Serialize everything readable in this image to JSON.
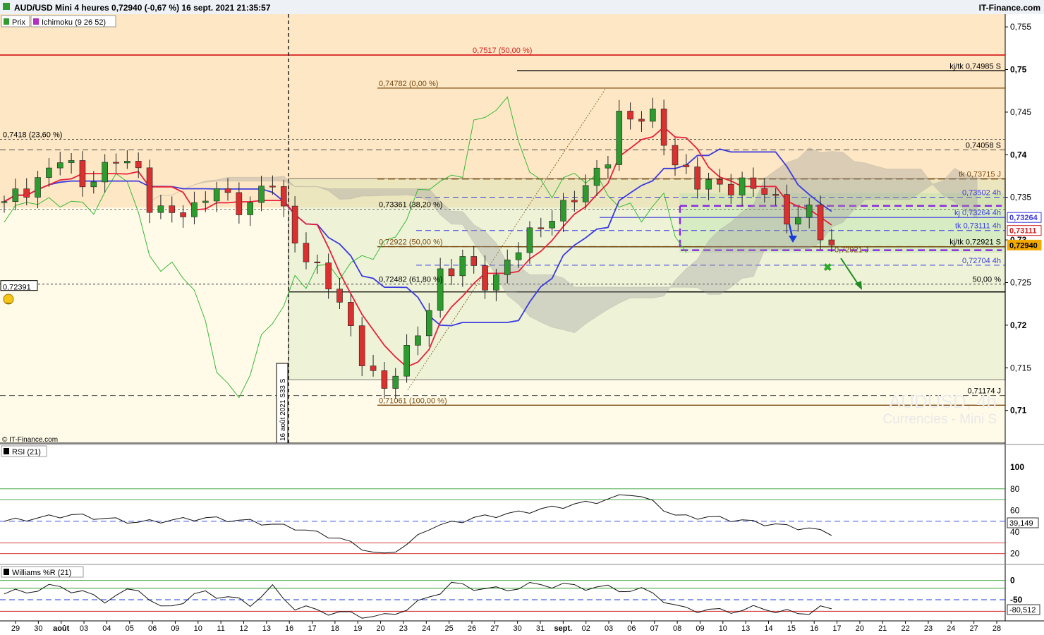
{
  "header": {
    "title": "AUD/USD Mini 4 heures 0,72940 (-0,67 %) 16 sept. 2021 21:35:57",
    "source": "IT-Finance.com"
  },
  "legend": {
    "price_label": "Prix",
    "ichimoku_label": "Ichimoku (9 26 52)"
  },
  "watermark": {
    "line1": "AUDUSD, 4h",
    "line2": "Currencies - Mini S"
  },
  "copyright": "© IT-Finance.com",
  "vertical_marker": "16 août 2021 S33 S",
  "colors": {
    "candle_up": "#2e9b2e",
    "candle_down": "#d93030",
    "tenkan": "#e8203a",
    "kijun": "#3a3ae0",
    "chikou": "#39b939",
    "fib": "#7a4a10",
    "resistance": "#d42020",
    "background": "#fde7c4"
  },
  "chart_data": [
    {
      "type": "candlestick",
      "title": "AUD/USD Mini 4 heures",
      "ylim": [
        0.7055,
        0.7565
      ],
      "y_ticks": [
        "0,755",
        "0,75",
        "0,745",
        "0,74",
        "0,735",
        "0,73",
        "0,725",
        "0,72",
        "0,715",
        "0,71"
      ],
      "x_ticks": [
        "29",
        "30",
        "août",
        "03",
        "04",
        "05",
        "06",
        "09",
        "10",
        "11",
        "12",
        "13",
        "16",
        "17",
        "18",
        "19",
        "20",
        "23",
        "24",
        "25",
        "26",
        "27",
        "30",
        "31",
        "sept.",
        "02",
        "03",
        "06",
        "07",
        "08",
        "09",
        "10",
        "13",
        "14",
        "15",
        "16",
        "17",
        "20",
        "21",
        "22",
        "23",
        "24",
        "27",
        "28"
      ],
      "close_waypoints": [
        {
          "x": 0,
          "y": 0.734
        },
        {
          "x": 5,
          "y": 0.7395
        },
        {
          "x": 7,
          "y": 0.7365
        },
        {
          "x": 10,
          "y": 0.7398
        },
        {
          "x": 12,
          "y": 0.7375
        },
        {
          "x": 13,
          "y": 0.7342
        },
        {
          "x": 15,
          "y": 0.7335
        },
        {
          "x": 17,
          "y": 0.733
        },
        {
          "x": 19,
          "y": 0.7365
        },
        {
          "x": 21,
          "y": 0.734
        },
        {
          "x": 22,
          "y": 0.7338
        },
        {
          "x": 24,
          "y": 0.737
        },
        {
          "x": 26,
          "y": 0.7302
        },
        {
          "x": 28,
          "y": 0.726
        },
        {
          "x": 30,
          "y": 0.7228
        },
        {
          "x": 32,
          "y": 0.7165
        },
        {
          "x": 34,
          "y": 0.7118
        },
        {
          "x": 35,
          "y": 0.7145
        },
        {
          "x": 37,
          "y": 0.7195
        },
        {
          "x": 39,
          "y": 0.7255
        },
        {
          "x": 40,
          "y": 0.726
        },
        {
          "x": 41,
          "y": 0.7278
        },
        {
          "x": 43,
          "y": 0.7255
        },
        {
          "x": 44,
          "y": 0.7255
        },
        {
          "x": 46,
          "y": 0.7288
        },
        {
          "x": 48,
          "y": 0.7322
        },
        {
          "x": 50,
          "y": 0.7338
        },
        {
          "x": 52,
          "y": 0.7358
        },
        {
          "x": 54,
          "y": 0.7402
        },
        {
          "x": 55,
          "y": 0.7448
        },
        {
          "x": 56,
          "y": 0.744
        },
        {
          "x": 58,
          "y": 0.7442
        },
        {
          "x": 60,
          "y": 0.7395
        },
        {
          "x": 62,
          "y": 0.7365
        },
        {
          "x": 64,
          "y": 0.736
        },
        {
          "x": 66,
          "y": 0.737
        },
        {
          "x": 68,
          "y": 0.7355
        },
        {
          "x": 70,
          "y": 0.7325
        },
        {
          "x": 72,
          "y": 0.7338
        },
        {
          "x": 73,
          "y": 0.7308
        },
        {
          "x": 74,
          "y": 0.7294
        }
      ],
      "levels": [
        {
          "label": "0,7517 (50,00 %)",
          "value": 0.7517,
          "kind": "resistance"
        },
        {
          "label": "kj/tk 0,74985 S",
          "value": 0.74985,
          "kind": "black"
        },
        {
          "label": "0,74782 (0,00 %)",
          "value": 0.74782,
          "kind": "fib"
        },
        {
          "label": "0,7418 (23,60 %)",
          "value": 0.7418,
          "kind": "dotted"
        },
        {
          "label": "0,74058 S",
          "value": 0.74058,
          "kind": "dashed"
        },
        {
          "label": "tk 0,73715 J",
          "value": 0.73715,
          "kind": "fib_dashed"
        },
        {
          "label": "0,73502 4h",
          "value": 0.73502,
          "kind": "blue_dashed"
        },
        {
          "label": "kj 0,73264 4h",
          "value": 0.73264,
          "kind": "blue"
        },
        {
          "label": "0,73361 (38,20 %)",
          "value": 0.73361,
          "kind": "dotted"
        },
        {
          "label": "tk 0,73111 4h",
          "value": 0.73111,
          "kind": "blue_dashed"
        },
        {
          "label": "0,72922 (50,00 %)",
          "value": 0.72922,
          "kind": "fib_dashed"
        },
        {
          "label": "kj/tk 0,72921 S",
          "value": 0.72921,
          "kind": "black"
        },
        {
          "label": "0,72921 J",
          "value": 0.72921,
          "kind": "fib"
        },
        {
          "label": "0,72704 4h",
          "value": 0.72704,
          "kind": "blue_dashed"
        },
        {
          "label": "0,72482 (61,80 %)",
          "value": 0.72482,
          "kind": "dotted"
        },
        {
          "label": "50,00 %",
          "value": 0.72482,
          "kind": "dotted"
        },
        {
          "label": "0,72391",
          "value": 0.72391,
          "kind": "black"
        },
        {
          "label": "0,71174 J",
          "value": 0.71174,
          "kind": "dashed"
        },
        {
          "label": "0,71061 (100,00 %)",
          "value": 0.71061,
          "kind": "fib"
        }
      ],
      "price_badges": [
        {
          "text": "0,73264",
          "value": 0.73264,
          "color": "#3a3ae0"
        },
        {
          "text": "0,73111",
          "value": 0.73111,
          "color": "#d42020"
        },
        {
          "text": "0,72940",
          "value": 0.7294,
          "color": "#f2a900"
        }
      ]
    },
    {
      "type": "line",
      "title": "RSI (21)",
      "ylim": [
        10,
        108
      ],
      "y_ticks": [
        "100",
        "80",
        "60",
        "40",
        "20"
      ],
      "ref_lines": [
        80,
        70,
        50,
        30,
        20
      ],
      "last_value": "39,149",
      "waypoints": [
        {
          "x": 0,
          "y": 50
        },
        {
          "x": 6,
          "y": 56
        },
        {
          "x": 12,
          "y": 49
        },
        {
          "x": 18,
          "y": 53
        },
        {
          "x": 22,
          "y": 50
        },
        {
          "x": 26,
          "y": 44
        },
        {
          "x": 30,
          "y": 34
        },
        {
          "x": 33,
          "y": 21
        },
        {
          "x": 34,
          "y": 19
        },
        {
          "x": 36,
          "y": 28
        },
        {
          "x": 38,
          "y": 44
        },
        {
          "x": 42,
          "y": 53
        },
        {
          "x": 46,
          "y": 58
        },
        {
          "x": 50,
          "y": 64
        },
        {
          "x": 54,
          "y": 70
        },
        {
          "x": 56,
          "y": 76
        },
        {
          "x": 58,
          "y": 68
        },
        {
          "x": 60,
          "y": 55
        },
        {
          "x": 64,
          "y": 53
        },
        {
          "x": 68,
          "y": 48
        },
        {
          "x": 72,
          "y": 43
        },
        {
          "x": 74,
          "y": 39
        }
      ]
    },
    {
      "type": "line",
      "title": "Williams %R (21)",
      "ylim": [
        -105,
        5
      ],
      "y_ticks": [
        "0",
        "-50"
      ],
      "ref_lines": [
        0,
        -20,
        -50,
        -80
      ],
      "last_value": "-80,512",
      "waypoints": [
        {
          "x": 0,
          "y": -35
        },
        {
          "x": 5,
          "y": -15
        },
        {
          "x": 9,
          "y": -50
        },
        {
          "x": 12,
          "y": -20
        },
        {
          "x": 14,
          "y": -75
        },
        {
          "x": 18,
          "y": -30
        },
        {
          "x": 22,
          "y": -60
        },
        {
          "x": 24,
          "y": -20
        },
        {
          "x": 26,
          "y": -70
        },
        {
          "x": 30,
          "y": -85
        },
        {
          "x": 34,
          "y": -95
        },
        {
          "x": 37,
          "y": -60
        },
        {
          "x": 40,
          "y": -10
        },
        {
          "x": 44,
          "y": -25
        },
        {
          "x": 48,
          "y": -10
        },
        {
          "x": 54,
          "y": -20
        },
        {
          "x": 58,
          "y": -30
        },
        {
          "x": 60,
          "y": -70
        },
        {
          "x": 64,
          "y": -80
        },
        {
          "x": 68,
          "y": -72
        },
        {
          "x": 71,
          "y": -88
        },
        {
          "x": 73,
          "y": -70
        },
        {
          "x": 74,
          "y": -80
        }
      ]
    }
  ]
}
